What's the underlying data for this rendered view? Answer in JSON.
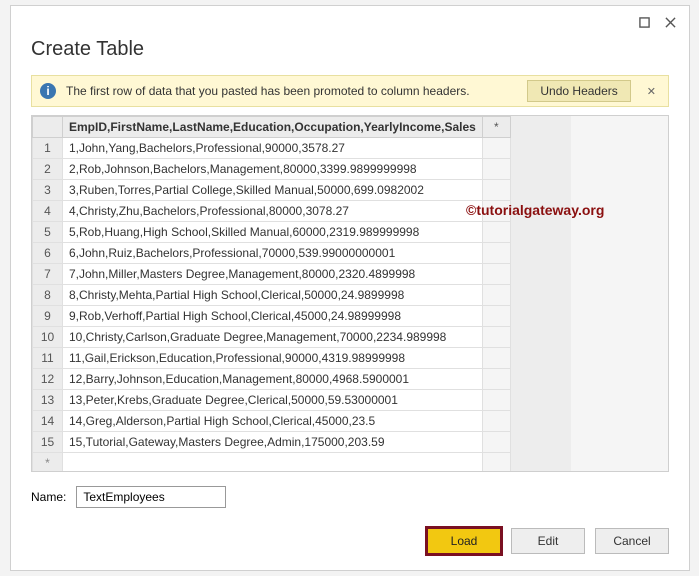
{
  "title": "Create Table",
  "banner": {
    "message": "The first row of data that you pasted has been promoted to column headers.",
    "undo_label": "Undo Headers"
  },
  "table": {
    "header": "EmpID,FirstName,LastName,Education,Occupation,YearlyIncome,Sales",
    "star": "*",
    "rows": [
      {
        "n": "1",
        "v": "1,John,Yang,Bachelors,Professional,90000,3578.27"
      },
      {
        "n": "2",
        "v": "2,Rob,Johnson,Bachelors,Management,80000,3399.9899999998"
      },
      {
        "n": "3",
        "v": "3,Ruben,Torres,Partial College,Skilled Manual,50000,699.0982002"
      },
      {
        "n": "4",
        "v": "4,Christy,Zhu,Bachelors,Professional,80000,3078.27"
      },
      {
        "n": "5",
        "v": "5,Rob,Huang,High School,Skilled Manual,60000,2319.989999998"
      },
      {
        "n": "6",
        "v": "6,John,Ruiz,Bachelors,Professional,70000,539.99000000001"
      },
      {
        "n": "7",
        "v": "7,John,Miller,Masters Degree,Management,80000,2320.4899998"
      },
      {
        "n": "8",
        "v": "8,Christy,Mehta,Partial High School,Clerical,50000,24.9899998"
      },
      {
        "n": "9",
        "v": "9,Rob,Verhoff,Partial High School,Clerical,45000,24.98999998"
      },
      {
        "n": "10",
        "v": "10,Christy,Carlson,Graduate Degree,Management,70000,2234.989998"
      },
      {
        "n": "11",
        "v": "11,Gail,Erickson,Education,Professional,90000,4319.98999998"
      },
      {
        "n": "12",
        "v": "12,Barry,Johnson,Education,Management,80000,4968.5900001"
      },
      {
        "n": "13",
        "v": "13,Peter,Krebs,Graduate Degree,Clerical,50000,59.53000001"
      },
      {
        "n": "14",
        "v": "14,Greg,Alderson,Partial High School,Clerical,45000,23.5"
      },
      {
        "n": "15",
        "v": "15,Tutorial,Gateway,Masters Degree,Admin,175000,203.59"
      }
    ],
    "empty_marker": "*"
  },
  "name": {
    "label": "Name:",
    "value": "TextEmployees"
  },
  "buttons": {
    "load": "Load",
    "edit": "Edit",
    "cancel": "Cancel"
  },
  "watermark": "©tutorialgateway.org"
}
